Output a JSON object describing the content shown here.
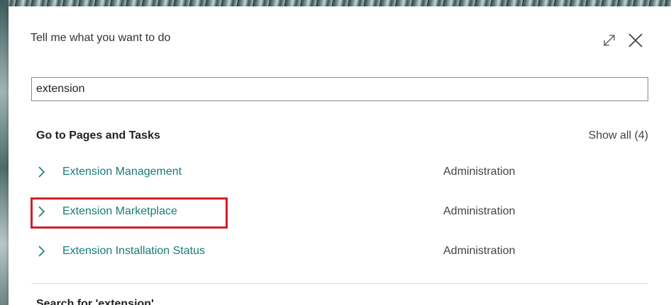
{
  "dialog": {
    "title": "Tell me what you want to do"
  },
  "search": {
    "value": "extension"
  },
  "section": {
    "header": "Go to Pages and Tasks",
    "show_all": "Show all (4)"
  },
  "results": [
    {
      "name": "Extension Management",
      "category": "Administration"
    },
    {
      "name": "Extension Marketplace",
      "category": "Administration",
      "highlighted": true
    },
    {
      "name": "Extension Installation Status",
      "category": "Administration"
    }
  ],
  "search_for": {
    "label": "Search for 'extension'"
  },
  "colors": {
    "link": "#1b7a78",
    "highlight": "#d01f2a"
  },
  "icons": [
    "expand-icon",
    "close-icon",
    "chevron-right-icon"
  ]
}
